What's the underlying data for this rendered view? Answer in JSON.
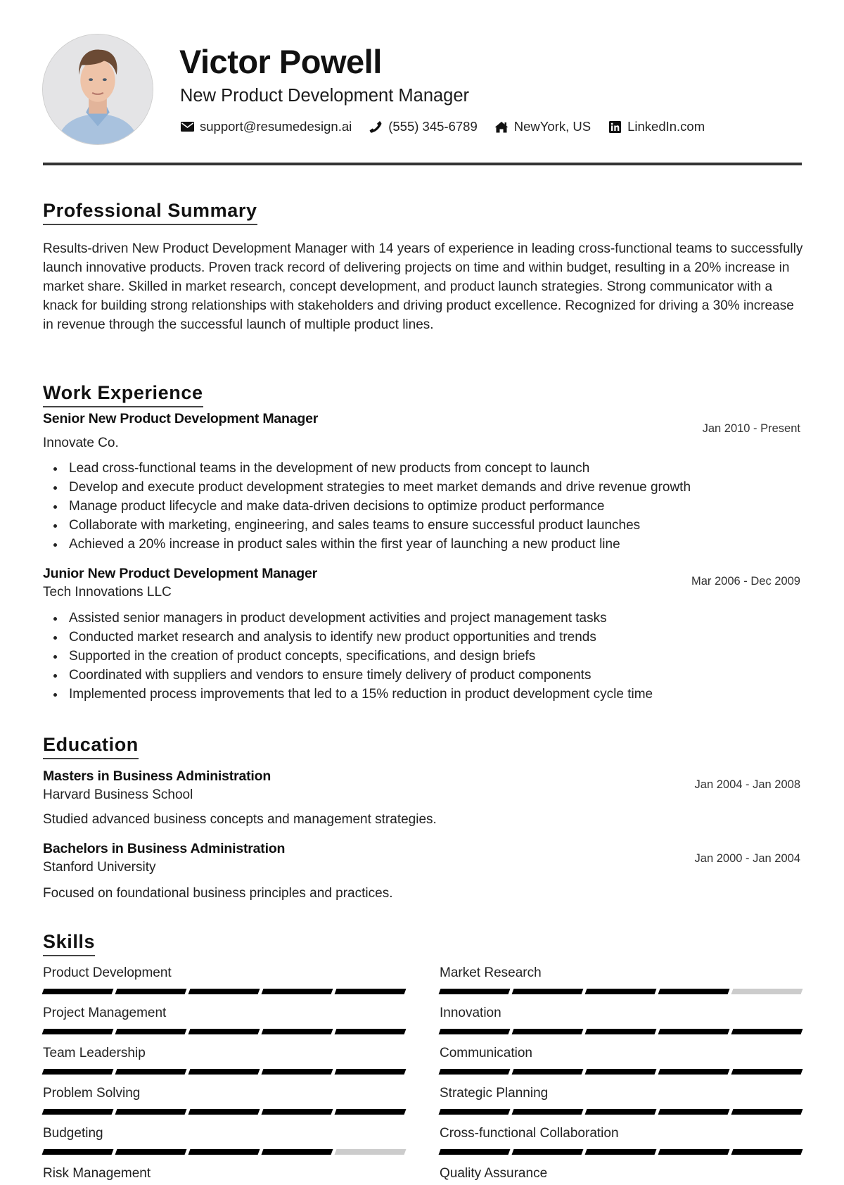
{
  "header": {
    "name": "Victor Powell",
    "title": "New Product Development Manager",
    "contacts": [
      {
        "icon": "envelope-icon",
        "text": "support@resumedesign.ai"
      },
      {
        "icon": "phone-icon",
        "text": "(555) 345-6789"
      },
      {
        "icon": "home-icon",
        "text": "NewYork, US"
      },
      {
        "icon": "linkedin-icon",
        "text": "LinkedIn.com"
      }
    ]
  },
  "summary": {
    "heading": "Professional Summary",
    "text": "Results-driven New Product Development Manager with 14 years of experience in leading cross-functional teams to successfully launch innovative products. Proven track record of delivering projects on time and within budget, resulting in a 20% increase in market share. Skilled in market research, concept development, and product launch strategies. Strong communicator with a knack for building strong relationships with stakeholders and driving product excellence. Recognized for driving a 30% increase in revenue through the successful launch of multiple product lines."
  },
  "experience": {
    "heading": "Work Experience",
    "jobs": [
      {
        "title": "Senior New Product Development Manager",
        "company": "Innovate Co.",
        "dates": "Jan 2010 - Present",
        "bullets": [
          "Lead cross-functional teams in the development of new products from concept to launch",
          "Develop and execute product development strategies to meet market demands and drive revenue growth",
          "Manage product lifecycle and make data-driven decisions to optimize product performance",
          "Collaborate with marketing, engineering, and sales teams to ensure successful product launches",
          "Achieved a 20% increase in product sales within the first year of launching a new product line"
        ]
      },
      {
        "title": "Junior New Product Development Manager",
        "company": "Tech Innovations LLC",
        "dates": "Mar 2006 - Dec 2009",
        "bullets": [
          "Assisted senior managers in product development activities and project management tasks",
          "Conducted market research and analysis to identify new product opportunities and trends",
          "Supported in the creation of product concepts, specifications, and design briefs",
          "Coordinated with suppliers and vendors to ensure timely delivery of product components",
          "Implemented process improvements that led to a 15% reduction in product development cycle time"
        ]
      }
    ]
  },
  "education": {
    "heading": "Education",
    "items": [
      {
        "degree": "Masters in Business Administration",
        "school": "Harvard Business School",
        "dates": "Jan 2004 - Jan 2008",
        "description": "Studied advanced business concepts and management strategies."
      },
      {
        "degree": "Bachelors in Business Administration",
        "school": "Stanford University",
        "dates": "Jan 2000 - Jan 2004",
        "description": "Focused on foundational business principles and practices."
      }
    ]
  },
  "skills": {
    "heading": "Skills",
    "scale_max": 5,
    "items": [
      {
        "name": "Product Development",
        "level": 5
      },
      {
        "name": "Market Research",
        "level": 4
      },
      {
        "name": "Project Management",
        "level": 5
      },
      {
        "name": "Innovation",
        "level": 5
      },
      {
        "name": "Team Leadership",
        "level": 5
      },
      {
        "name": "Communication",
        "level": 5
      },
      {
        "name": "Problem Solving",
        "level": 5
      },
      {
        "name": "Strategic Planning",
        "level": 5
      },
      {
        "name": "Budgeting",
        "level": 4
      },
      {
        "name": "Cross-functional Collaboration",
        "level": 5
      },
      {
        "name": "Risk Management",
        "level": null
      },
      {
        "name": "Quality Assurance",
        "level": null
      }
    ]
  },
  "colors": {
    "text": "#222222",
    "rule": "#333333",
    "skill_on": "#000000",
    "skill_off": "#cccccc"
  }
}
